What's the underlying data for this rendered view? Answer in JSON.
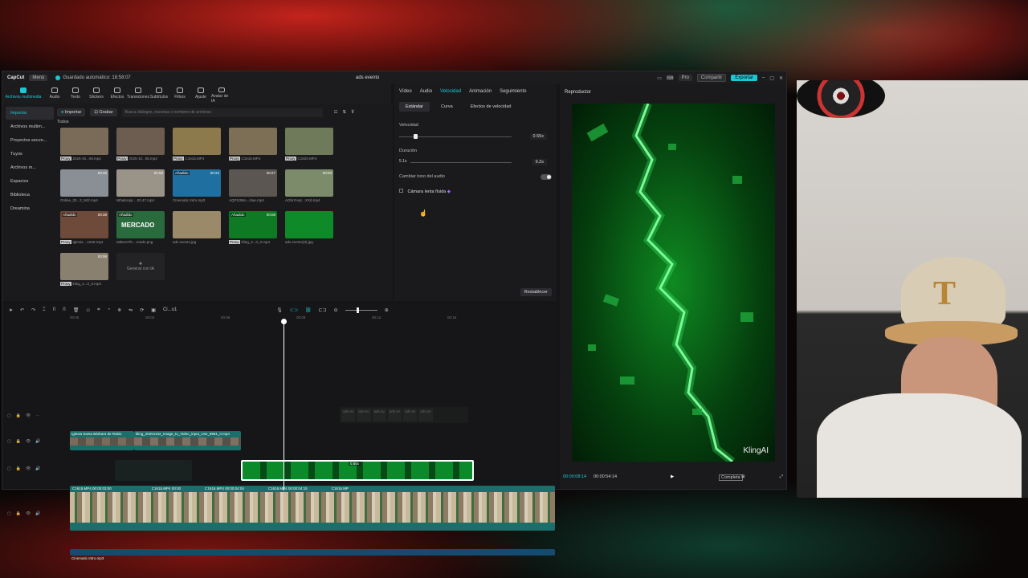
{
  "app": {
    "logo": "CapCut",
    "menu": "Menú",
    "autosave": "Guardado automático: 18:58:07",
    "project_title": "ads evento",
    "pro": "Pro",
    "share": "Compartir",
    "export": "Exportar"
  },
  "toolbar": [
    "Archivos multimedia",
    "Audio",
    "Texto",
    "Stickers",
    "Efectos",
    "Transiciones",
    "Subtítulos",
    "Filtros",
    "Ajuste",
    "Avatar de IA"
  ],
  "sidebar": [
    "Importar",
    "Archivos multim...",
    "Proyectos secun...",
    "Tuyos",
    "Archivos m...",
    "Espacios",
    "Biblioteca",
    "Dreamina"
  ],
  "media": {
    "import_btn": "Importar",
    "record_btn": "Grabar",
    "search_placeholder": "Busca diálogos, escenas o nombres de archivos",
    "section": "Todos",
    "items": [
      {
        "label": "2025-10...09.mp4",
        "badge": "Proxy",
        "color": "#7a6a58"
      },
      {
        "label": "2025-10...05.mp4",
        "badge": "Proxy",
        "color": "#6c5d50"
      },
      {
        "label": "C1615.MP4",
        "badge": "Proxy",
        "color": "#8c7a4c"
      },
      {
        "label": "C1616.MP4",
        "badge": "Proxy",
        "color": "#7d6f55"
      },
      {
        "label": "C1620.MP4",
        "badge": "Proxy",
        "color": "#6f7a5a"
      },
      {
        "label": "Online_20...2_942.mp4",
        "dur": "00:40",
        "color": "#8a8f95"
      },
      {
        "label": "WhatsApp ...03.47.mp4",
        "dur": "01:02",
        "color": "#9a9388"
      },
      {
        "label": "Cinematic Intro.mp3",
        "dur": "00:23",
        "add": "Añadido",
        "color": "#1f6fa0"
      },
      {
        "label": "AQPS3Wo...i3ae.mp4",
        "dur": "00:27",
        "color": "#5c5652"
      },
      {
        "label": "AOfuYHqc...XXd.mp4",
        "dur": "00:03",
        "color": "#7c8c6a"
      },
      {
        "label": "Iglesia ...1648.mp4",
        "dur": "00:38",
        "add": "Añadido",
        "badge": "Proxy",
        "color": "#6e4a3a"
      },
      {
        "label": "0d6ec07b-...erado.png",
        "add": "Añadido",
        "color": "#2a6b3e"
      },
      {
        "label": "ads evento.jpg",
        "color": "#9a8a6a"
      },
      {
        "label": "kling_2...0_0.mp4",
        "dur": "00:06",
        "add": "Añadido",
        "badge": "Proxy",
        "color": "#0e7a24"
      },
      {
        "label": "ads evento(3).jpg",
        "color": "#0f8a28"
      },
      {
        "label": "kling_2...0_0.mp4",
        "dur": "00:06",
        "badge": "Proxy",
        "color": "#8a8070"
      }
    ],
    "mercado": "MERCADO",
    "generate": "Generar con IA"
  },
  "props": {
    "tabs": [
      "Vídeo",
      "Audio",
      "Velocidad",
      "Animación",
      "Seguimiento"
    ],
    "subtabs": [
      "Estándar",
      "Curva",
      "Efectos de velocidad"
    ],
    "speed_label": "Velocidad",
    "speed_value": "0.55x",
    "speed_fraction": 0.06,
    "duration_label": "Duración",
    "duration_from": "5.1s",
    "duration_value": "9.2s",
    "pitch_label": "Cambiar tono del audio",
    "smooth_label": "Cámara lenta fluida",
    "reset": "Restablecer"
  },
  "player": {
    "title": "Reproductor",
    "watermark": "KlingAI",
    "current_time": "00:00:08:14",
    "total_time": "00:00:54:14",
    "ratio": "Completa"
  },
  "timeline": {
    "zoom_label": "Cl...o1",
    "ruler": [
      "00:00",
      "00:03",
      "00:06",
      "00:09",
      "00:12",
      "00:15"
    ],
    "clip_a_label": "Iglesia Santa Bárbara de Rubio ",
    "clip_b_label": "kling_20251102_Image_to_Video_input_Use_9961_0.mp4",
    "speed_clip": "0.55x",
    "main_labels": [
      "C1615.MP4  00:00:03:00",
      "C1615.MP4  00:00",
      "C1616.MP4  00:00:04:04",
      "C1616.MP4  00:00:04:15",
      "C1616.MP"
    ],
    "audio_label": "Cinematic Intro.mp3",
    "ghost_labels": [
      "ads ev",
      "ads ev",
      "ads ev",
      "ads ev",
      "ads ev",
      "ads ev"
    ]
  }
}
